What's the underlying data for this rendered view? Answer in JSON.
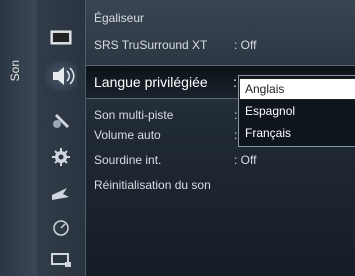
{
  "tab": {
    "label": "Son"
  },
  "icons": [
    "picture-icon",
    "sound-icon",
    "channel-icon",
    "setup-icon",
    "input-icon",
    "application-icon",
    "support-icon"
  ],
  "menu": {
    "items": [
      {
        "label": "Égaliseur",
        "value": ""
      },
      {
        "label": "SRS TruSurround XT",
        "value": ": Off"
      },
      {
        "label": "Langue privilégiée",
        "value": ":"
      },
      {
        "label": "Son multi-piste",
        "value": ":"
      },
      {
        "label": "Volume auto",
        "value": ":"
      },
      {
        "label": "Sourdine int.",
        "value": ": Off"
      },
      {
        "label": "Réinitialisation du son",
        "value": ""
      }
    ]
  },
  "dropdown": {
    "options": [
      "Anglais",
      "Espagnol",
      "Français"
    ],
    "selected": "Anglais"
  }
}
